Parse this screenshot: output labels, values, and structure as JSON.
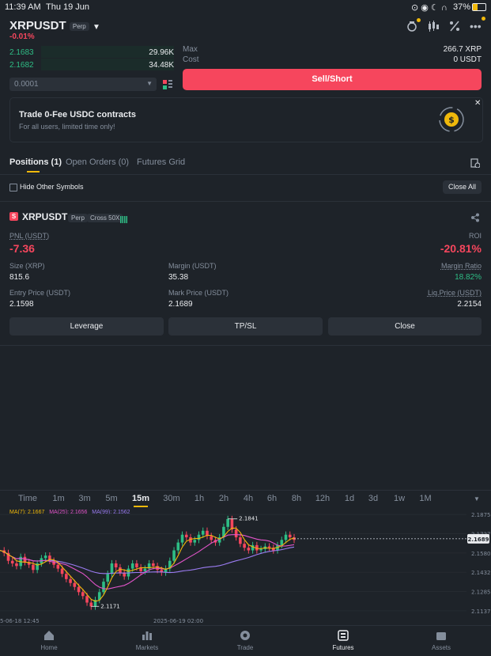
{
  "status": {
    "time": "11:39 AM",
    "date": "Thu 19 Jun",
    "battery": "37%"
  },
  "header": {
    "symbol": "XRPUSDT",
    "tag": "Perp",
    "change": "-0.01%"
  },
  "orderbook": {
    "rows": [
      {
        "price": "2.1683",
        "qty": "29.96K"
      },
      {
        "price": "2.1682",
        "qty": "34.48K"
      }
    ],
    "precision": "0.0001"
  },
  "order": {
    "max_label": "Max",
    "max_value": "266.7 XRP",
    "cost_label": "Cost",
    "cost_value": "0 USDT",
    "sell_label": "Sell/Short"
  },
  "promo": {
    "title": "Trade 0-Fee USDC contracts",
    "subtitle": "For all users, limited time only!"
  },
  "tabs": [
    {
      "label": "Positions (1)"
    },
    {
      "label": "Open Orders (0)"
    },
    {
      "label": "Futures Grid"
    }
  ],
  "filters": {
    "hide_label": "Hide Other Symbols",
    "close_all": "Close All"
  },
  "position": {
    "symbol": "XRPUSDT",
    "tag1": "Perp",
    "tag2": "Cross 50X",
    "pnl_label": "PNL (USDT)",
    "pnl": "-7.36",
    "roi_label": "ROI",
    "roi": "-20.81%",
    "size_label": "Size (XRP)",
    "size": "815.6",
    "margin_label": "Margin (USDT)",
    "margin": "35.38",
    "ratio_label": "Margin Ratio",
    "ratio": "18.82%",
    "entry_label": "Entry Price (USDT)",
    "entry": "2.1598",
    "mark_label": "Mark Price (USDT)",
    "mark": "2.1689",
    "liq_label": "Liq.Price (USDT)",
    "liq": "2.2154",
    "btn_leverage": "Leverage",
    "btn_tpsl": "TP/SL",
    "btn_close": "Close"
  },
  "timeframes": [
    "Time",
    "1m",
    "3m",
    "5m",
    "15m",
    "30m",
    "1h",
    "2h",
    "4h",
    "6h",
    "8h",
    "12h",
    "1d",
    "3d",
    "1w",
    "1M"
  ],
  "active_timeframe": "15m",
  "ma": {
    "ma7": "MA(7): 2.1667",
    "ma25": "MA(25): 2.1656",
    "ma99": "MA(99): 2.1562"
  },
  "colors": {
    "ma7": "#f0b90b",
    "ma25": "#e154c9",
    "ma99": "#9b7cf2"
  },
  "chart_data": {
    "type": "line",
    "title": "",
    "y_ticks": [
      "2.1875",
      "2.1727",
      "2.1580",
      "2.1432",
      "2.1285",
      "2.1137"
    ],
    "ylim": [
      2.11,
      2.19
    ],
    "x_labels": [
      "5-06-18 12:45",
      "2025-06-19 02:00"
    ],
    "annotations": {
      "high": "2.1841",
      "low": "2.1171",
      "current": "2.1689"
    },
    "series": [
      {
        "values": [
          2.16,
          2.158,
          2.152,
          2.15,
          2.148,
          2.155,
          2.151,
          2.149,
          2.145,
          2.15,
          2.154,
          2.156,
          2.152,
          2.149,
          2.146,
          2.142,
          2.138,
          2.135,
          2.132,
          2.128,
          2.125,
          2.12,
          2.117,
          2.122,
          2.128,
          2.136,
          2.142,
          2.15,
          2.147,
          2.143,
          2.14,
          2.146,
          2.15,
          2.147,
          2.144,
          2.146,
          2.15,
          2.148,
          2.145,
          2.143,
          2.146,
          2.152,
          2.16,
          2.166,
          2.172,
          2.17,
          2.166,
          2.168,
          2.172,
          2.175,
          2.171,
          2.168,
          2.166,
          2.17,
          2.178,
          2.184,
          2.176,
          2.17,
          2.165,
          2.162,
          2.16,
          2.164,
          2.16,
          2.161,
          2.163,
          2.162,
          2.16,
          2.164,
          2.168,
          2.172,
          2.17,
          2.168
        ]
      }
    ]
  }
}
